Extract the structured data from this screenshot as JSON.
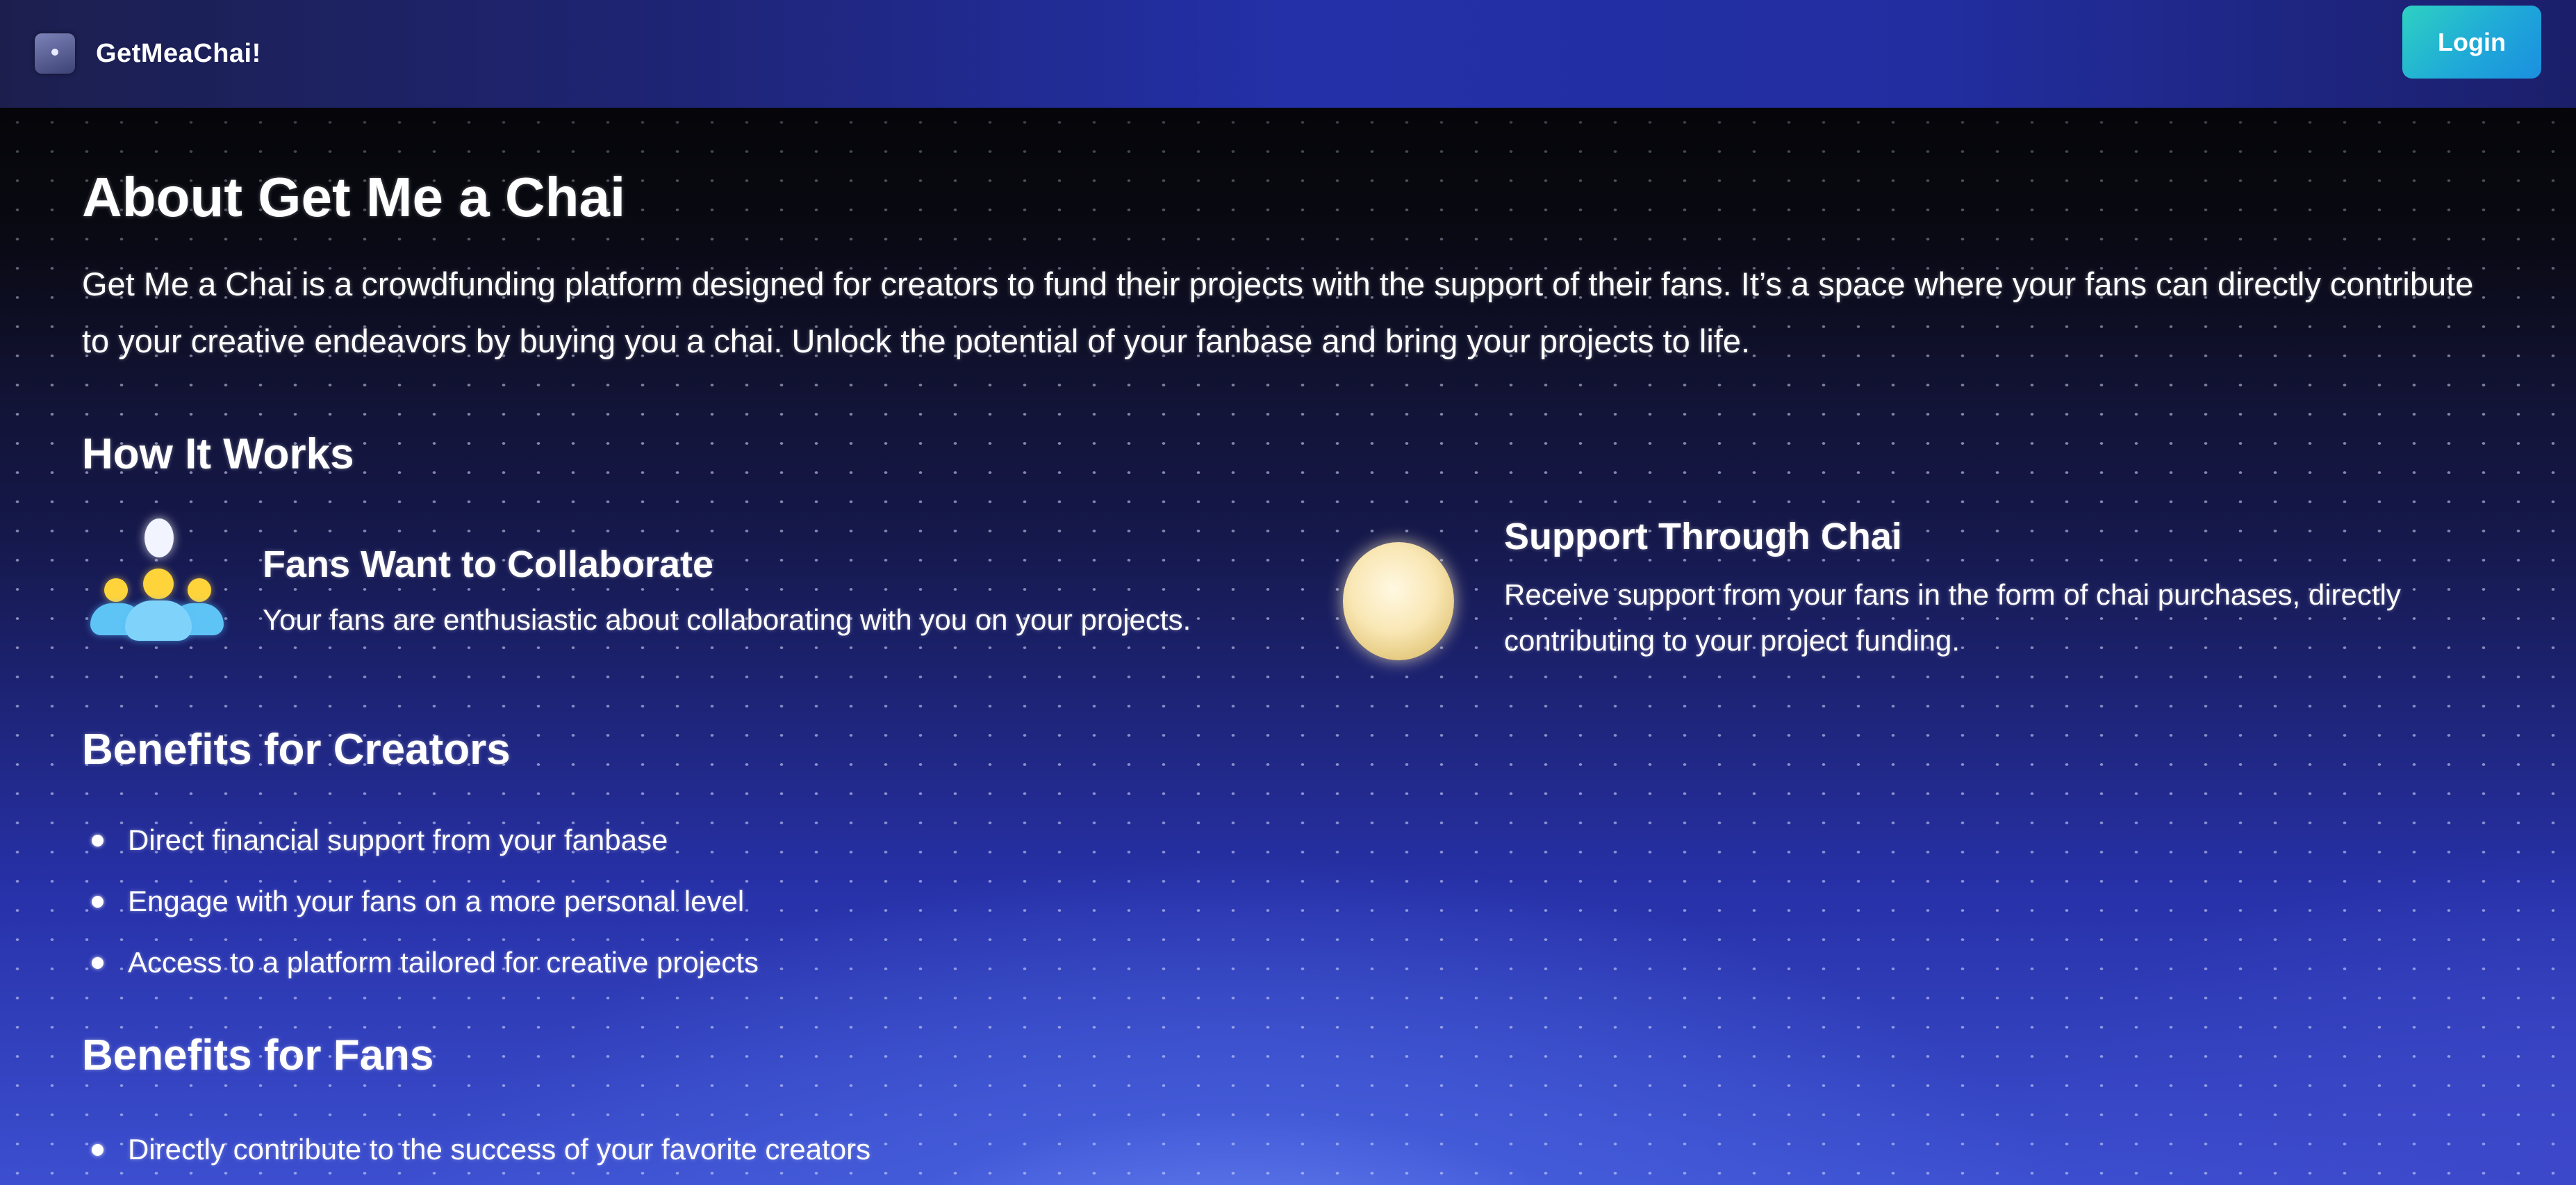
{
  "navbar": {
    "brand_icon": "chai-cup-icon",
    "brand": "GetMeaChai!",
    "login_label": "Login"
  },
  "about": {
    "title": "About Get Me a Chai",
    "intro": "Get Me a Chai is a crowdfunding platform designed for creators to fund their projects with the support of their fans. It’s a space where your fans can directly contribute to your creative endeavors by buying you a chai. Unlock the potential of your fanbase and bring your projects to life."
  },
  "how_it_works": {
    "title": "How It Works",
    "items": [
      {
        "icon": "group-people-icon",
        "title": "Fans Want to Collaborate",
        "description": "Your fans are enthusiastic about collaborating with you on your projects."
      },
      {
        "icon": "coin-icon",
        "title": "Support Through Chai",
        "description": "Receive support from your fans in the form of chai purchases, directly contributing to your project funding."
      }
    ]
  },
  "creators": {
    "title": "Benefits for Creators",
    "items": [
      "Direct financial support from your fanbase",
      "Engage with your fans on a more personal level",
      "Access to a platform tailored for creative projects"
    ]
  },
  "fans": {
    "title": "Benefits for Fans",
    "items": [
      "Directly contribute to the success of your favorite creators"
    ]
  },
  "colors": {
    "navbar_gradient": [
      "#1c1f4e",
      "#2330a8"
    ],
    "login_button": [
      "#2ed1c2",
      "#1b8fe0"
    ],
    "background_bottom": "#3c4fd0",
    "icon_yellow": "#ffd43b",
    "icon_blue": "#5ec4f5"
  }
}
